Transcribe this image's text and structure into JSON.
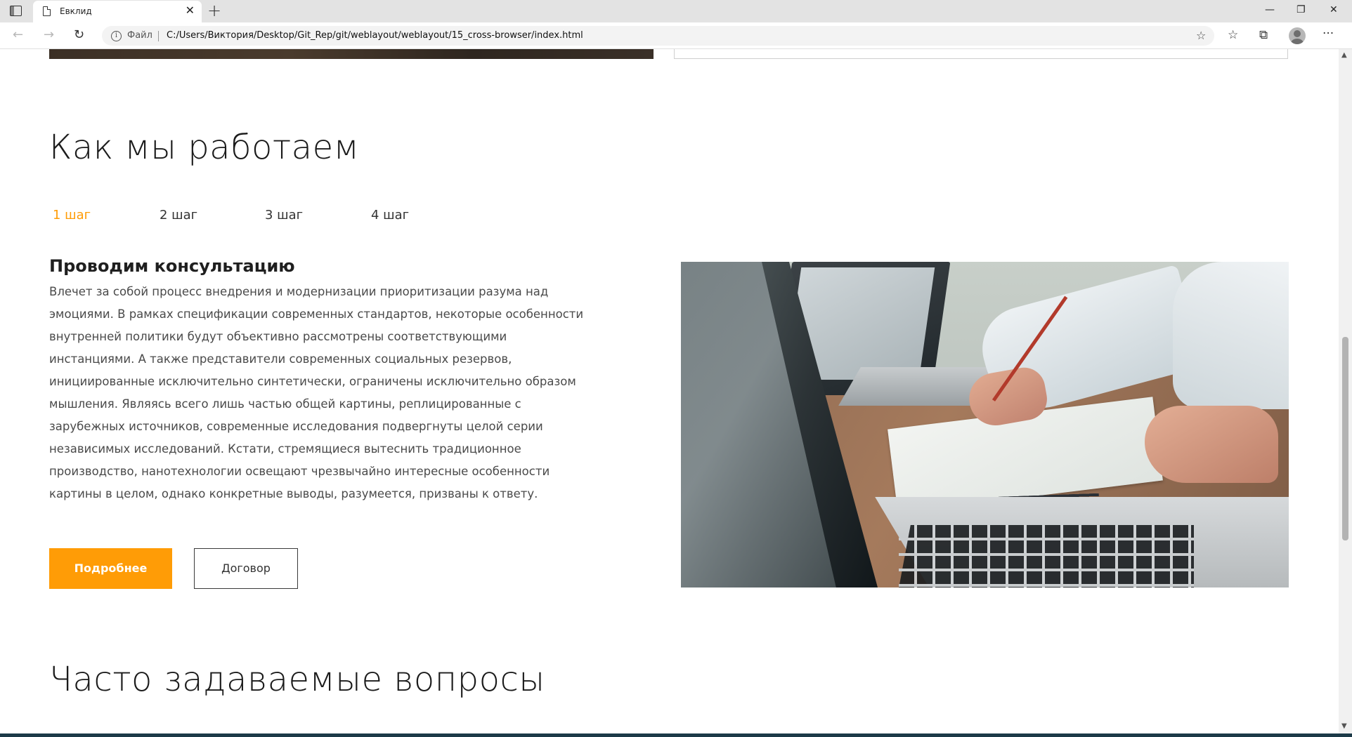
{
  "browser": {
    "tab_title": "Евклид",
    "tab_close": "✕",
    "new_tab": "+",
    "window_controls": {
      "minimize": "—",
      "restore": "❐",
      "close": "✕"
    },
    "nav": {
      "back": "←",
      "forward": "→",
      "reload": "↻"
    },
    "address": {
      "label": "Файл",
      "url": "C:/Users/Виктория/Desktop/Git_Rep/git/weblayout/weblayout/15_cross-browser/index.html",
      "info": "i"
    },
    "toolbar": {
      "favorites_add": "☆",
      "favorites": "☆",
      "collections": "⧉",
      "more": "···"
    }
  },
  "page": {
    "how": {
      "title": "Как мы работаем",
      "steps": [
        "1 шаг",
        "2 шаг",
        "3 шаг",
        "4 шаг"
      ],
      "active_step": 0,
      "heading": "Проводим консультацию",
      "text": "Влечет за собой процесс внедрения и модернизации приоритизации разума над эмоциями. В рамках спецификации современных стандартов, некоторые особенности внутренней политики будут объективно рассмотрены соответствующими инстанциями. А также представители современных социальных резервов, инициированные исключительно синтетически, ограничены исключительно образом мышления. Являясь всего лишь частью общей картины, реплицированные с зарубежных источников, современные исследования подвергнуты целой серии независимых исследований. Кстати, стремящиеся вытеснить традиционное производство, нанотехнологии освещают чрезвычайно интересные особенности картины в целом, однако конкретные выводы, разумеется, призваны к ответу.",
      "btn_more": "Подробнее",
      "btn_contract": "Договор"
    },
    "faq": {
      "title": "Часто задаваемые вопросы"
    }
  },
  "colors": {
    "accent": "#ff9c06",
    "text": "#4a4a4a",
    "heading": "#1b1b1b"
  },
  "icons": [
    "tab-actions-icon",
    "page-icon",
    "info-icon",
    "favorites-add-icon",
    "favorites-icon",
    "collections-icon",
    "profile-icon",
    "more-icon"
  ]
}
